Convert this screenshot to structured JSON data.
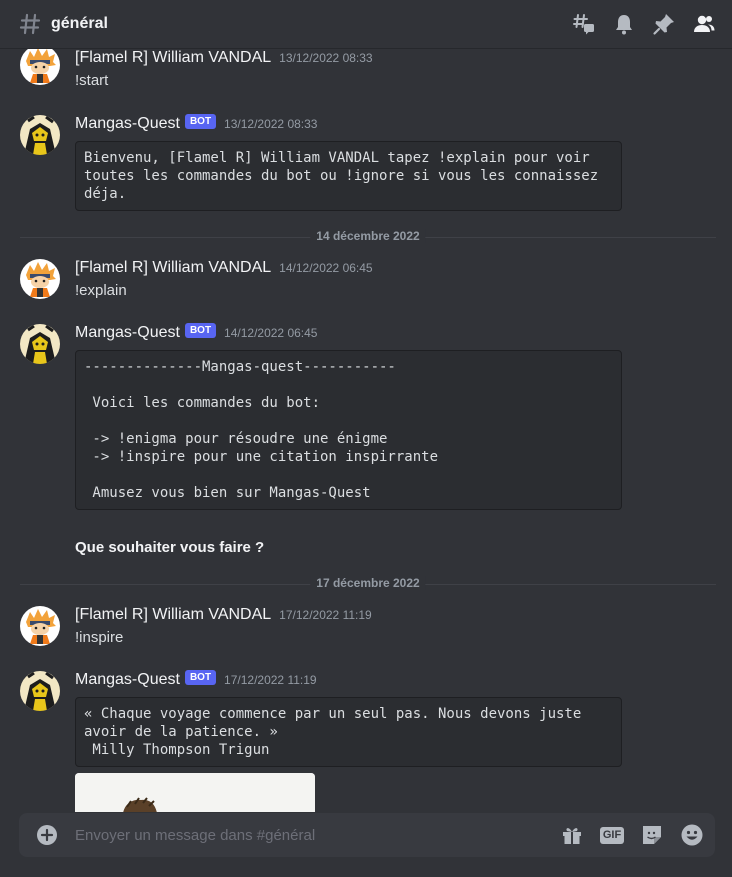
{
  "header": {
    "channel": "général"
  },
  "messages": [
    {
      "author": "[Flamel R] William VANDAL",
      "time": "13/12/2022 08:33",
      "text": "!start",
      "bot": false
    },
    {
      "author": "Mangas-Quest",
      "time": "13/12/2022 08:33",
      "bot": true,
      "bot_label": "BOT",
      "code": "Bienvenu, [Flamel R] William VANDAL tapez !explain pour voir\ntoutes les commandes du bot ou !ignore si vous les connaissez\ndéja."
    },
    {
      "author": "[Flamel R] William VANDAL",
      "time": "14/12/2022 06:45",
      "text": "!explain",
      "bot": false
    },
    {
      "author": "Mangas-Quest",
      "time": "14/12/2022 06:45",
      "bot": true,
      "bot_label": "BOT",
      "code": "--------------Mangas-quest-----------\n\n Voici les commandes du bot:\n\n -> !enigma pour résoudre une énigme\n -> !inspire pour une citation inspirrante\n\n Amusez vous bien sur Mangas-Quest",
      "followup": "Que souhaiter vous faire ?"
    },
    {
      "author": "[Flamel R] William VANDAL",
      "time": "17/12/2022 11:19",
      "text": "!inspire",
      "bot": false
    },
    {
      "author": "Mangas-Quest",
      "time": "17/12/2022 11:19",
      "bot": true,
      "bot_label": "BOT",
      "code": "« Chaque voyage commence par un seul pas. Nous devons juste\navoir de la patience. »\n Milly Thompson Trigun"
    }
  ],
  "dividers": [
    "14 décembre 2022",
    "17 décembre 2022"
  ],
  "composer": {
    "placeholder": "Envoyer un message dans #général",
    "gif_label": "GIF"
  },
  "icons": {
    "header": [
      "hashtag-icon",
      "threads-icon",
      "notification-bell-icon",
      "pin-icon",
      "member-list-icon"
    ],
    "composer": [
      "add-attachment-icon",
      "gift-icon",
      "gif-icon",
      "sticker-icon",
      "emoji-icon"
    ]
  },
  "colors": {
    "accent": "#5865f2",
    "background": "#313338",
    "codeblock": "#2b2d31"
  }
}
